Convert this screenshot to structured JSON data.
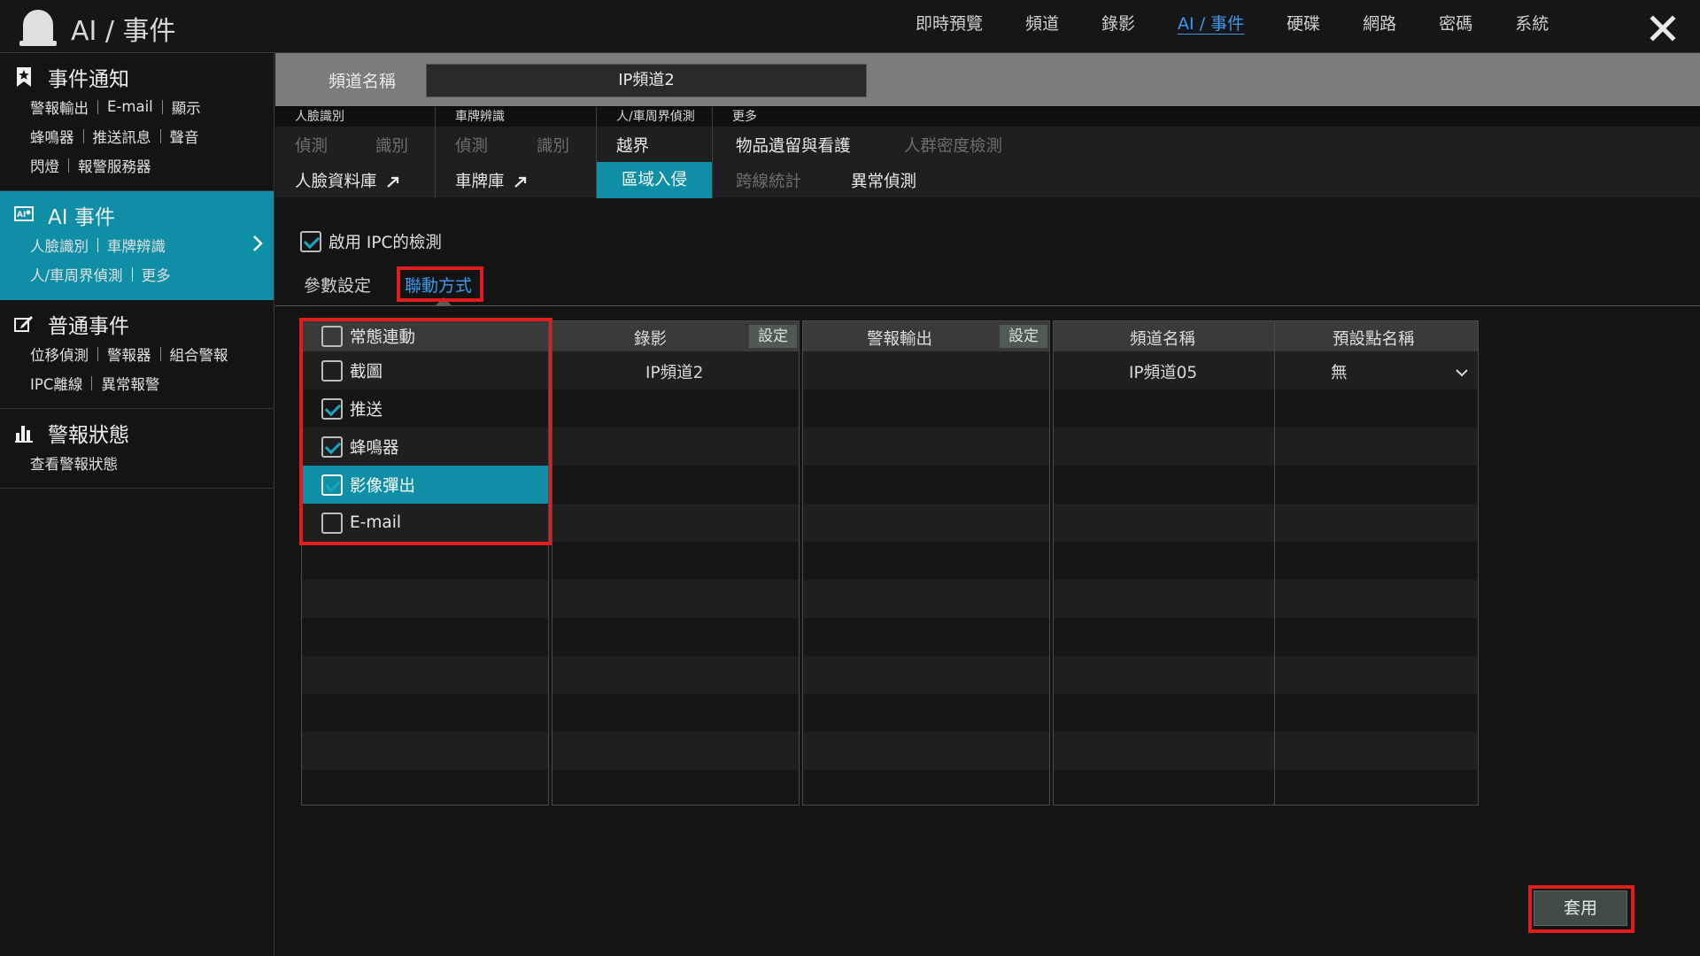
{
  "app": {
    "title": "AI / 事件"
  },
  "topnav": [
    {
      "label": "即時預覽",
      "active": false
    },
    {
      "label": "頻道",
      "active": false
    },
    {
      "label": "錄影",
      "active": false
    },
    {
      "label": "AI / 事件",
      "active": true
    },
    {
      "label": "硬碟",
      "active": false
    },
    {
      "label": "網路",
      "active": false
    },
    {
      "label": "密碼",
      "active": false
    },
    {
      "label": "系統",
      "active": false
    }
  ],
  "sidebar": {
    "groups": [
      {
        "title": "事件通知",
        "icon": "bookmark-icon",
        "rows": [
          [
            "警報輸出",
            "E-mail",
            "顯示"
          ],
          [
            "蜂鳴器",
            "推送訊息",
            "聲音"
          ],
          [
            "閃燈",
            "報警服務器"
          ]
        ]
      },
      {
        "title": "AI 事件",
        "icon": "ai-icon",
        "active": true,
        "rows": [
          [
            "人臉識別",
            "車牌辨識"
          ],
          [
            "人/車周界偵測",
            "更多"
          ]
        ]
      },
      {
        "title": "普通事件",
        "icon": "edit-icon",
        "rows": [
          [
            "位移偵測",
            "警報器",
            "組合警報"
          ],
          [
            "IPC離線",
            "異常報警"
          ]
        ]
      },
      {
        "title": "警報狀態",
        "icon": "chart-icon",
        "rows": [
          [
            "查看警報狀態"
          ]
        ]
      }
    ]
  },
  "channel": {
    "label": "頻道名稱",
    "value": "IP頻道2"
  },
  "categories": {
    "face": {
      "title": "人臉識別",
      "detect": "偵測",
      "recognize": "識別",
      "db": "人臉資料庫"
    },
    "plate": {
      "title": "車牌辨識",
      "detect": "偵測",
      "recognize": "識別",
      "db": "車牌庫"
    },
    "perimeter": {
      "title": "人/車周界偵測",
      "cross": "越界",
      "intrusion": "區域入侵"
    },
    "more": {
      "title": "更多",
      "item1": "物品遺留與看護",
      "item2": "人群密度檢測",
      "item3": "跨線統計",
      "item4": "異常偵測"
    }
  },
  "enable": {
    "label": "啟用 IPC的檢測",
    "checked": true
  },
  "subtabs": {
    "params": "參數設定",
    "linkage": "聯動方式",
    "active": "linkage"
  },
  "linkage": {
    "header": {
      "label": "常態連動",
      "checked": false
    },
    "items": [
      {
        "label": "截圖",
        "checked": false
      },
      {
        "label": "推送",
        "checked": true
      },
      {
        "label": "蜂鳴器",
        "checked": true
      },
      {
        "label": "影像彈出",
        "checked": true,
        "selected": true
      },
      {
        "label": "E-mail",
        "checked": false
      }
    ]
  },
  "record": {
    "header": "錄影",
    "set": "設定",
    "rows": [
      "IP頻道2"
    ]
  },
  "alarm_out": {
    "header": "警報輸出",
    "set": "設定"
  },
  "preset": {
    "col1": "頻道名稱",
    "col2": "預設點名稱",
    "channel": "IP頻道05",
    "point": "無"
  },
  "apply": "套用",
  "colors": {
    "accent": "#0e8fa6",
    "link_active": "#3a9bf0",
    "highlight": "#e11c1c"
  }
}
